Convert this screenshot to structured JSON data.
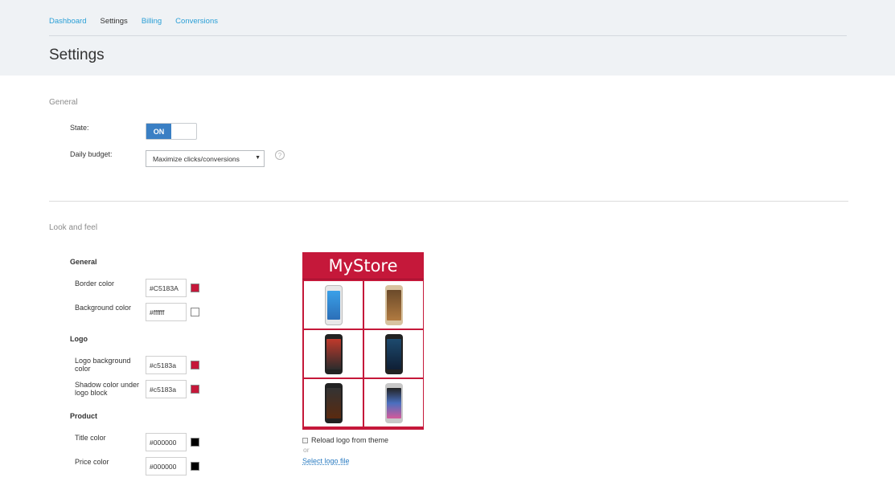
{
  "tabs": [
    {
      "label": "Dashboard",
      "active": false
    },
    {
      "label": "Settings",
      "active": true
    },
    {
      "label": "Billing",
      "active": false
    },
    {
      "label": "Conversions",
      "active": false
    }
  ],
  "page_title": "Settings",
  "general": {
    "title": "General",
    "state_label": "State:",
    "state_value": "ON",
    "budget_label": "Daily budget:",
    "budget_value": "Maximize clicks/conversions",
    "help_icon": "?"
  },
  "look_and_feel": {
    "title": "Look and feel",
    "general_heading": "General",
    "border_color_label": "Border color",
    "border_color_value": "#C5183A",
    "background_color_label": "Background color",
    "background_color_value": "#ffffff",
    "logo_heading": "Logo",
    "logo_bg_label": "Logo background color",
    "logo_bg_value": "#c5183a",
    "shadow_label": "Shadow color under logo block",
    "shadow_value": "#c5183a",
    "product_heading": "Product",
    "title_color_label": "Title color",
    "title_color_value": "#000000",
    "price_color_label": "Price color",
    "price_color_value": "#000000"
  },
  "preview": {
    "logo_text": "MyStore",
    "reload_label": "Reload logo from theme",
    "or_text": "or",
    "select_logo_link": "Select logo file"
  },
  "colors": {
    "accent": "#2a9fd6",
    "brand": "#C5183A",
    "toggle_on": "#3a7fc4"
  }
}
